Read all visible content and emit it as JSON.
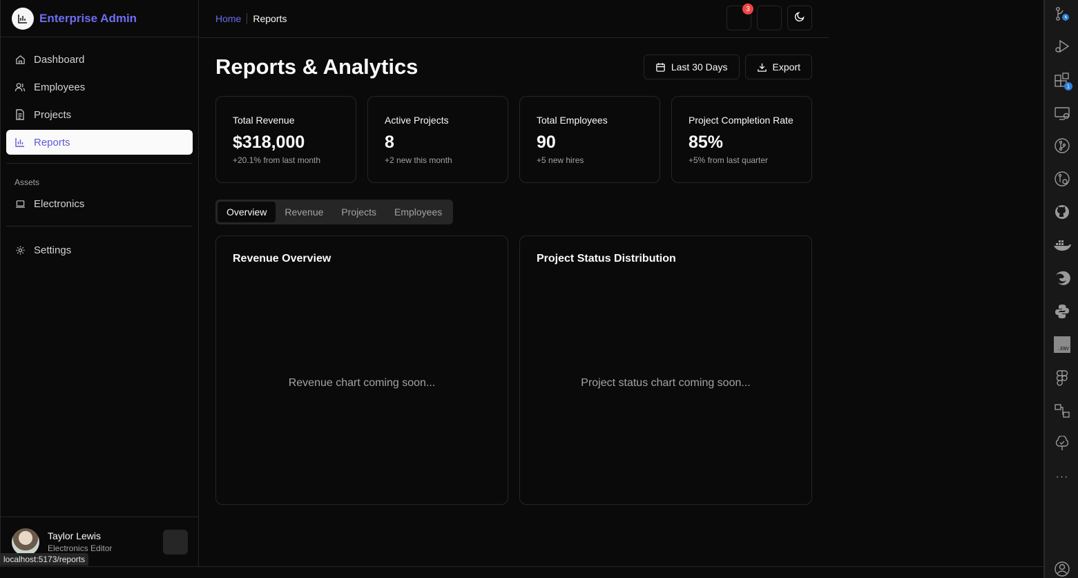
{
  "app": {
    "title": "Enterprise Admin"
  },
  "sidebar": {
    "items": [
      {
        "label": "Dashboard",
        "icon": "home-icon"
      },
      {
        "label": "Employees",
        "icon": "users-icon"
      },
      {
        "label": "Projects",
        "icon": "file-icon"
      },
      {
        "label": "Reports",
        "icon": "bar-chart-icon",
        "active": true
      }
    ],
    "assets_label": "Assets",
    "assets_items": [
      {
        "label": "Electronics",
        "icon": "laptop-icon"
      }
    ],
    "settings": {
      "label": "Settings",
      "icon": "gear-icon"
    }
  },
  "user": {
    "name": "Taylor Lewis",
    "role": "Electronics Editor"
  },
  "status_url": "localhost:5173/reports",
  "breadcrumb": {
    "home": "Home",
    "current": "Reports"
  },
  "header": {
    "notifications_count": "3"
  },
  "page": {
    "title": "Reports & Analytics",
    "date_range_label": "Last 30 Days",
    "export_label": "Export"
  },
  "stats": [
    {
      "label": "Total Revenue",
      "value": "$318,000",
      "sub": "+20.1% from last month"
    },
    {
      "label": "Active Projects",
      "value": "8",
      "sub": "+2 new this month"
    },
    {
      "label": "Total Employees",
      "value": "90",
      "sub": "+5 new hires"
    },
    {
      "label": "Project Completion Rate",
      "value": "85%",
      "sub": "+5% from last quarter"
    }
  ],
  "tabs": [
    "Overview",
    "Revenue",
    "Projects",
    "Employees"
  ],
  "panels": [
    {
      "title": "Revenue Overview",
      "empty": "Revenue chart coming soon..."
    },
    {
      "title": "Project Status Distribution",
      "empty": "Project status chart coming soon..."
    }
  ],
  "activity_bar": {
    "extensions_badge": "1",
    "env_label": ".ENV",
    "more_label": "···"
  },
  "colors": {
    "accent": "#6d6df0",
    "badge": "#ef4444",
    "background": "#0a0a0a"
  }
}
